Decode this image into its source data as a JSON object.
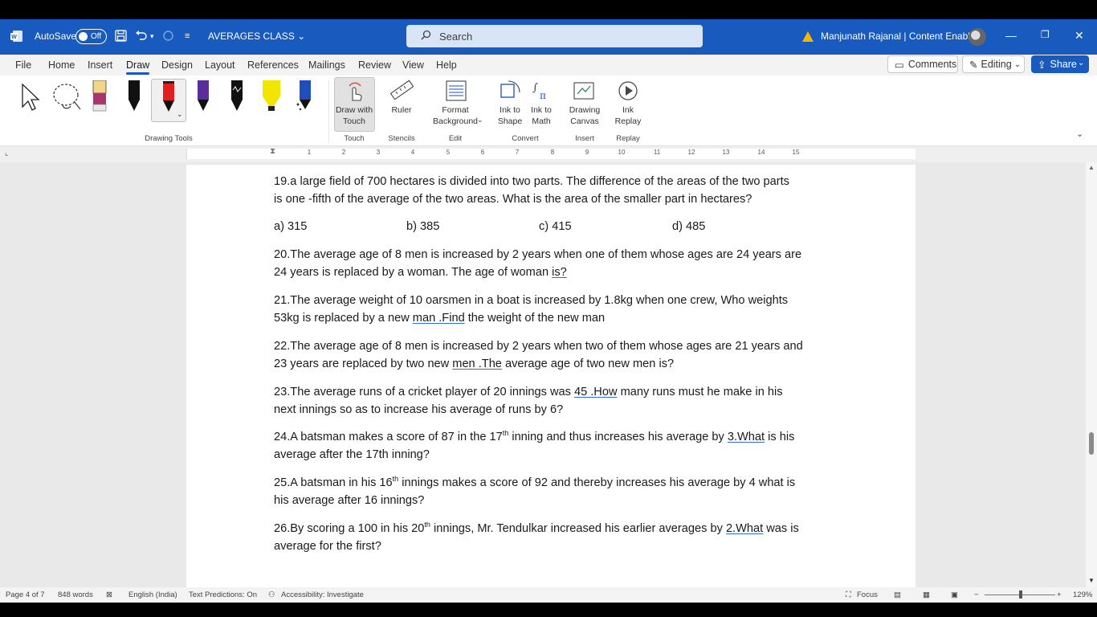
{
  "titlebar": {
    "autosave_label": "AutoSave",
    "autosave_state": "Off",
    "doc_title": "AVERAGES CLASS",
    "search_placeholder": "Search",
    "user_name": "Manjunath Rajanal | Content Enablers"
  },
  "menu": {
    "tabs": [
      "File",
      "Home",
      "Insert",
      "Draw",
      "Design",
      "Layout",
      "References",
      "Mailings",
      "Review",
      "View",
      "Help"
    ],
    "active_tab": "Draw",
    "comments_label": "Comments",
    "editing_label": "Editing",
    "share_label": "Share"
  },
  "ribbon": {
    "groups": {
      "drawing_tools": "Drawing Tools",
      "touch": "Touch",
      "stencils": "Stencils",
      "edit": "Edit",
      "convert": "Convert",
      "insert": "Insert",
      "replay": "Replay"
    },
    "buttons": {
      "draw_with_touch_1": "Draw with",
      "draw_with_touch_2": "Touch",
      "ruler": "Ruler",
      "format_bg_1": "Format",
      "format_bg_2": "Background",
      "ink_shape_1": "Ink to",
      "ink_shape_2": "Shape",
      "ink_math_1": "Ink to",
      "ink_math_2": "Math",
      "drawing_canvas_1": "Drawing",
      "drawing_canvas_2": "Canvas",
      "ink_replay_1": "Ink",
      "ink_replay_2": "Replay"
    },
    "pen_colors": [
      "#111111",
      "#e02020",
      "#5a2d9a",
      "#111111",
      "#f2e600",
      "#1f4fbf"
    ]
  },
  "ruler_ticks": [
    "1",
    "2",
    "3",
    "4",
    "5",
    "6",
    "7",
    "8",
    "9",
    "10",
    "11",
    "12",
    "13",
    "14",
    "15"
  ],
  "document": {
    "q19_line1": "19.a large field of 700 hectares is divided into two parts. The difference of the areas of the two parts",
    "q19_line2": "is one -fifth of the average of the two areas. What is the area of the smaller part in hectares?",
    "q19_options": [
      "a) 315",
      "b) 385",
      "c) 415",
      "d) 485"
    ],
    "q20_line1": "20.The average age of 8 men is increased by 2 years when one of them whose ages are 24 years are",
    "q20_line2a": "24 years is replaced by a woman. The age of woman ",
    "q20_line2b": "is?",
    "q21_line1": "21.The average weight of 10 oarsmen in a boat is increased by 1.8kg when one crew, Who weights",
    "q21_line2a": "53kg is replaced by a new ",
    "q21_line2b": "man .Find",
    "q21_line2c": " the weight of the new man",
    "q22_line1": "22.The average age of 8 men is increased by 2 years when two of them whose ages are 21 years and",
    "q22_line2a": "23 years are replaced by two new ",
    "q22_line2b": "men .The",
    "q22_line2c": " average age of two new men is?",
    "q23_line1a": "23.The average runs of a cricket player of 20 innings was ",
    "q23_line1b": "45 .How",
    "q23_line1c": " many runs must he make in his",
    "q23_line2": "next innings so as to increase his average of runs by 6?",
    "q24_line1a": "24.A batsman makes a score of 87 in the 17",
    "q24_sup": "th",
    "q24_line1b": " inning and thus increases his average by ",
    "q24_line1c": "3.What",
    "q24_line1d": " is his",
    "q24_line2": "average after the 17th inning?",
    "q25_line1a": "25.A batsman in his 16",
    "q25_sup": "th",
    "q25_line1b": " innings makes a score of 92 and thereby increases his average by 4 what is",
    "q25_line2": "his average after 16 innings?",
    "q26_line1a": "26.By scoring a 100 in his 20",
    "q26_sup": "th",
    "q26_line1b": " innings, Mr. Tendulkar increased his earlier averages by ",
    "q26_line1c": "2.What",
    "q26_line1d": " was is",
    "q26_line2": "average for the first?"
  },
  "statusbar": {
    "page": "Page 4 of 7",
    "words": "848 words",
    "language": "English (India)",
    "text_predictions": "Text Predictions: On",
    "accessibility": "Accessibility: Investigate",
    "focus": "Focus",
    "zoom": "129%"
  }
}
